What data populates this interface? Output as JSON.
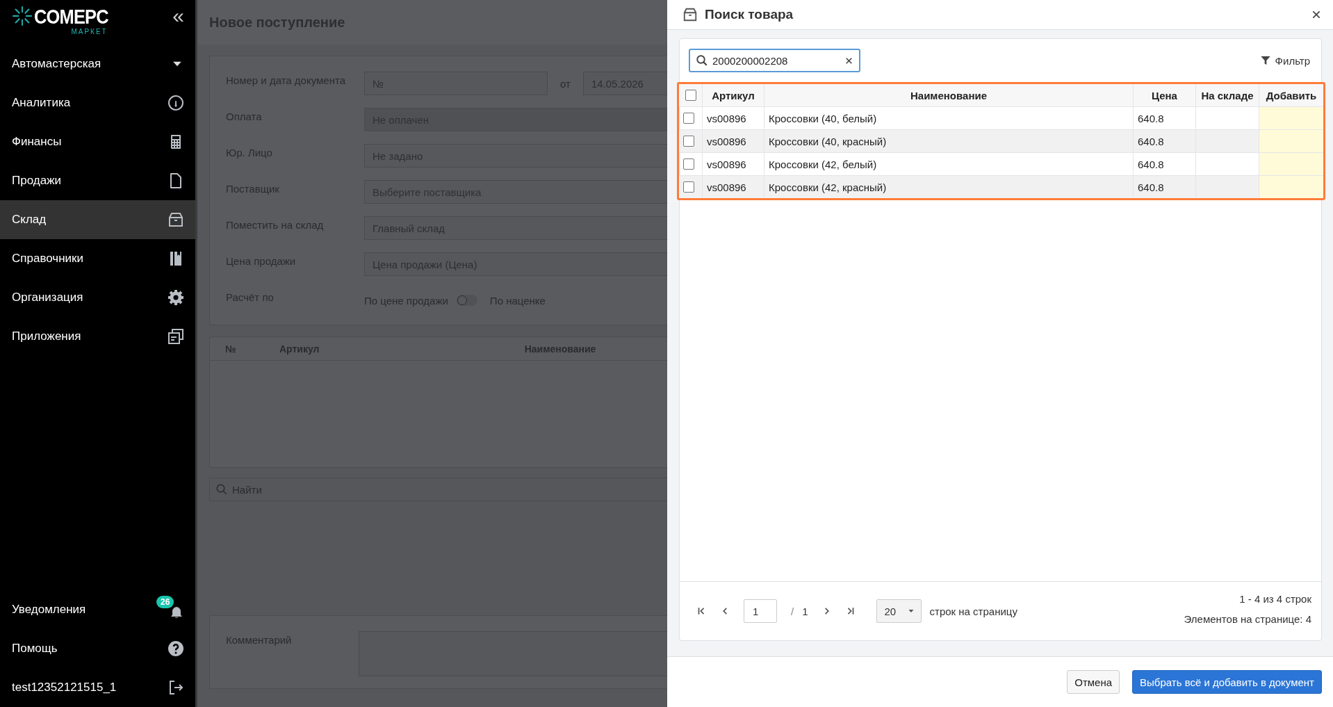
{
  "sidebar": {
    "logo": {
      "brand": "COMEPC",
      "sub": "МАРКЕТ"
    },
    "collapse": "«",
    "org": "Автомастерская",
    "items": [
      {
        "label": "Аналитика",
        "selected": false
      },
      {
        "label": "Финансы",
        "selected": false
      },
      {
        "label": "Продажи",
        "selected": false
      },
      {
        "label": "Склад",
        "selected": true
      },
      {
        "label": "Справочники",
        "selected": false
      },
      {
        "label": "Организация",
        "selected": false
      },
      {
        "label": "Приложения",
        "selected": false
      }
    ],
    "notifications": {
      "label": "Уведомления",
      "badge": "26"
    },
    "help": "Помощь",
    "user": "test12352121515_1"
  },
  "document": {
    "title": "Новое поступление",
    "number_label": "Номер и дата документа",
    "number_placeholder": "№",
    "date_sep": "от",
    "date": "14.05.2026",
    "fields": [
      {
        "label": "Оплата",
        "kind": "disabled",
        "value": "Не оплачен"
      },
      {
        "label": "Юр. Лицо",
        "kind": "select",
        "value": "Не задано"
      },
      {
        "label": "Поставщик",
        "kind": "input",
        "placeholder": "Выберите поставщика"
      },
      {
        "label": "Поместить на склад",
        "kind": "select",
        "value": "Главный склад"
      },
      {
        "label": "Цена продажи",
        "kind": "input",
        "value": "Цена продажи (Цена)"
      }
    ],
    "calc": {
      "label": "Расчёт по",
      "left": "По цене продажи",
      "right": "По наценке",
      "on": false
    },
    "columns": [
      "№",
      "Артикул",
      "Наименование"
    ],
    "search_placeholder": "Найти",
    "comment_label": "Комментарий"
  },
  "modal": {
    "title": "Поиск товара",
    "search": "2000200002208",
    "filter": "Фильтр",
    "select_all": false,
    "columns": [
      "Артикул",
      "Наименование",
      "Цена",
      "На складе",
      "Добавить"
    ],
    "rows": [
      {
        "checked": false,
        "sku": "vs00896",
        "name": "Кроссовки (40, белый)",
        "price": "640.8"
      },
      {
        "checked": false,
        "sku": "vs00896",
        "name": "Кроссовки (40, красный)",
        "price": "640.8"
      },
      {
        "checked": false,
        "sku": "vs00896",
        "name": "Кроссовки (42, белый)",
        "price": "640.8"
      },
      {
        "checked": false,
        "sku": "vs00896",
        "name": "Кроссовки (42, красный)",
        "price": "640.8"
      }
    ],
    "pagination": {
      "page": "1",
      "separator": "/",
      "total_pages": "1",
      "per_page": "20",
      "per_page_label": "строк на страницу",
      "range": "1 - 4 из 4 строк",
      "elements": "Элементов на странице: 4"
    },
    "buttons": [
      {
        "kind": "secondary",
        "label": "Отмена"
      },
      {
        "kind": "primary",
        "label": "Выбрать всё и добавить в документ"
      }
    ]
  }
}
